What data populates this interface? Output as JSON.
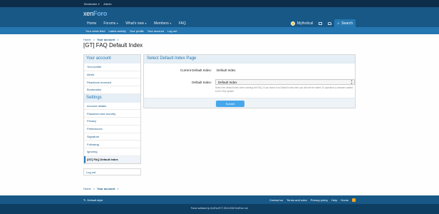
{
  "staff_bar": {
    "moderator": "Moderator",
    "admin": "Admin"
  },
  "logo": {
    "part1": "xen",
    "part2": "Foro"
  },
  "nav": {
    "items": [
      "Home",
      "Forums",
      "What's new",
      "Members",
      "FAQ"
    ],
    "user_name": "Mythotical",
    "search_label": "Search"
  },
  "subnav": [
    "Your news feed",
    "Latest activity",
    "Your profile",
    "Your account",
    "Log out"
  ],
  "breadcrumb": {
    "home": "Home",
    "sep": ">",
    "current": "Your account"
  },
  "page_title": "[GT] FAQ Default Index",
  "sidebar": {
    "heading": "Your account",
    "items": [
      "Your profile",
      "Alerts",
      "Reactions received",
      "Bookmarks"
    ],
    "settings_heading": "Settings",
    "settings_items": [
      "Account details",
      "Password and security",
      "Privacy",
      "Preferences",
      "Signature",
      "Following",
      "Ignoring",
      "[GT] FAQ Default Index"
    ],
    "logout": "Log out"
  },
  "panel": {
    "heading": "Select Default Index Page",
    "current_label": "Current Default Index:",
    "current_value": "Default Index",
    "default_label": "Default Index:",
    "select_value": "Default Index",
    "hint": "Select the default index when viewing the FAQ. If you leave it as Default Index then you will see the latest 10 questions & answers added to the FAQ system.",
    "submit": "Submit"
  },
  "footer": {
    "style_chooser": "Default style",
    "links": [
      "Contact us",
      "Terms and rules",
      "Privacy policy",
      "Help",
      "Home"
    ],
    "copyright": "Forum software by XenForo® © 2010-2018 XenForo Ltd."
  },
  "colors": {
    "brand": "#185886",
    "accent": "#2577b1",
    "button": "#47a7eb"
  }
}
